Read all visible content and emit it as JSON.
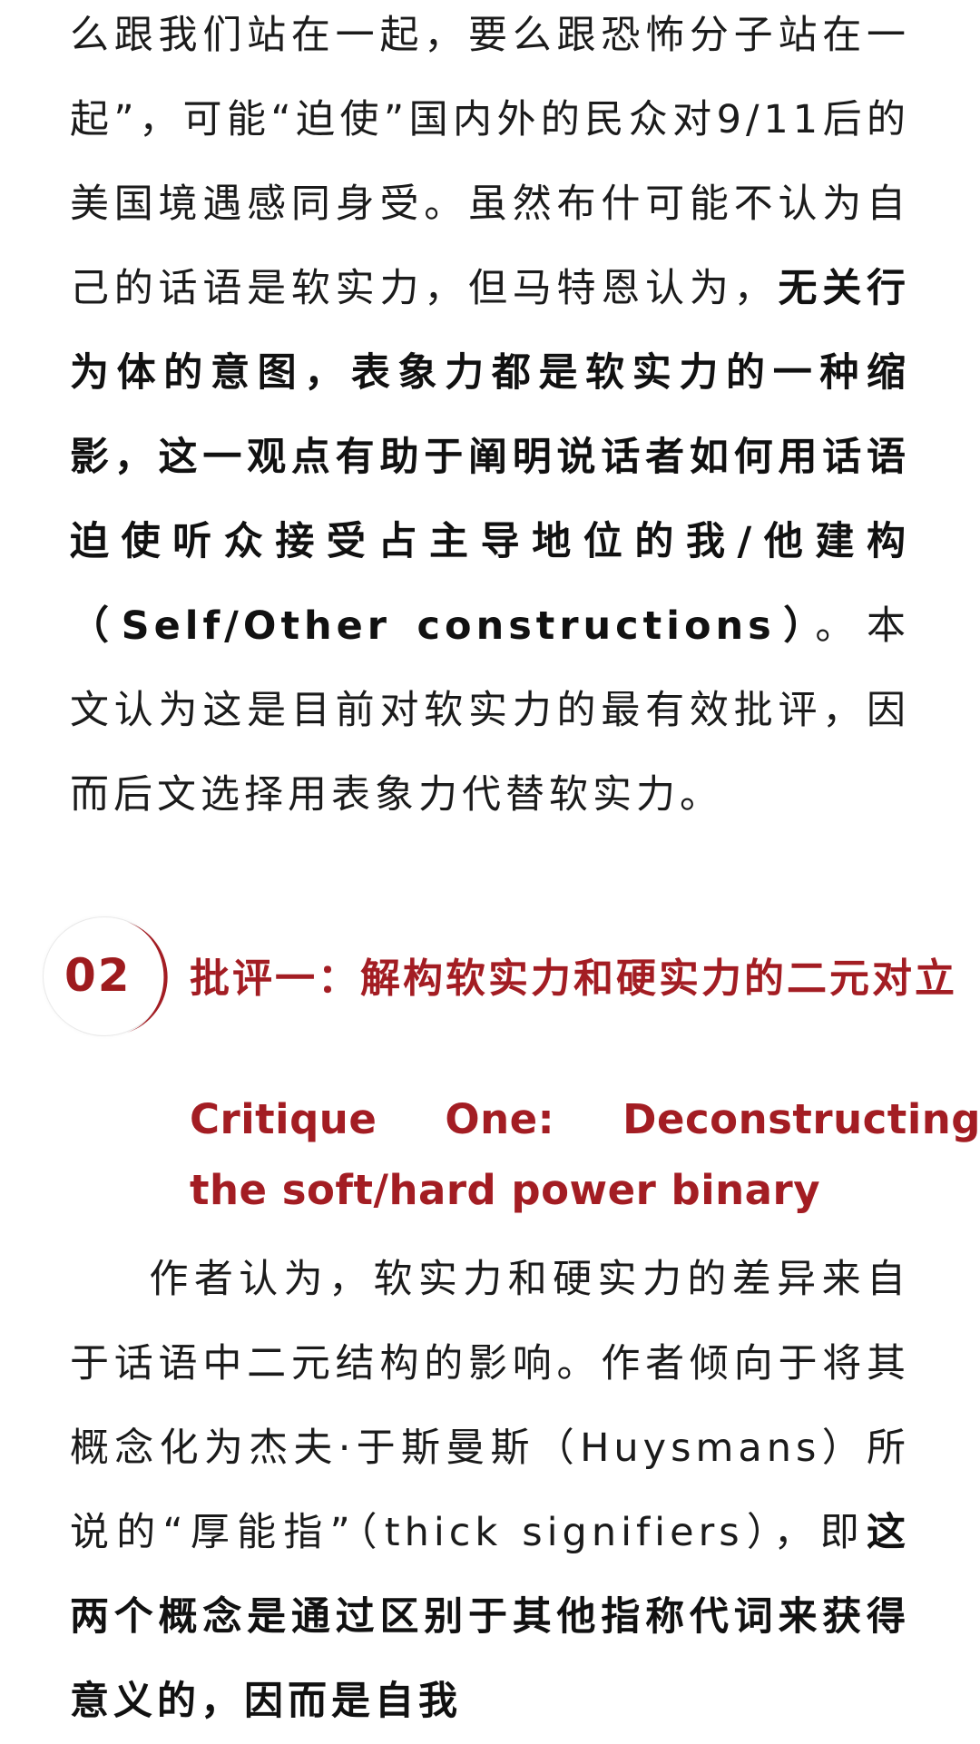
{
  "article": {
    "para1": {
      "text_a": "么跟我们站在一起，要么跟恐怖分子站在一起”，可能“迫使”国内外的民众对9/11后的美国境遇感同身受。虽然布什可能不认为自己的话语是软实力，但马特恩认为，",
      "bold_a": "无关行为体的意图，表象力都是软实力的一种缩影，这一观点有助于阐明说话者如何用话语迫使听众接受占主导地位的我/他建构（Self/Other constructions）",
      "text_b": "。本文认为这是目前对软实力的最有效批评，因而后文选择用表象力代替软实力。"
    },
    "section": {
      "number": "02",
      "title_cn": "批评一：解构软实力和硬实力的二元对立",
      "title_en_line1": "Critique One: Deconstructing",
      "title_en_line2": "the soft/hard power binary"
    },
    "para2": {
      "text_a": "作者认为，软实力和硬实力的差异来自于话语中二元结构的影响。作者倾向于将其概念化为杰夫·于斯曼斯（Huysmans）所说的“厚能指”（thick signifiers），即",
      "bold_a": "这两个概念是通过区别于其他指称代词来获得意义的，因而是自我"
    },
    "colors": {
      "accent": "#a31d23",
      "text": "#1b1b1b",
      "background": "#ffffff"
    }
  }
}
